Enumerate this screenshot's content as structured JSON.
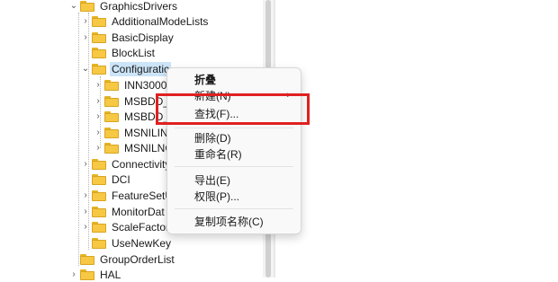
{
  "tree": {
    "items": [
      {
        "label": "GraphicsDrivers",
        "expanded": true
      },
      {
        "label": "AdditionalModeLists"
      },
      {
        "label": "BasicDisplay"
      },
      {
        "label": "BlockList"
      },
      {
        "label": "Configuratic",
        "expanded": true,
        "selected": true
      },
      {
        "label": "INN3000"
      },
      {
        "label": "MSBDD_"
      },
      {
        "label": "MSBDD_"
      },
      {
        "label": "MSNILIN"
      },
      {
        "label": "MSNILNC"
      },
      {
        "label": "Connectivity"
      },
      {
        "label": "DCI"
      },
      {
        "label": "FeatureSetU"
      },
      {
        "label": "MonitorDat"
      },
      {
        "label": "ScaleFactors"
      },
      {
        "label": "UseNewKey"
      },
      {
        "label": "GroupOrderList"
      },
      {
        "label": "HAL"
      }
    ]
  },
  "context_menu": {
    "collapse": "折叠",
    "new": "新建(N)",
    "find": "查找(F)...",
    "delete": "删除(D)",
    "rename": "重命名(R)",
    "export": "导出(E)",
    "permissions": "权限(P)...",
    "copy_key_name": "复制项名称(C)"
  },
  "icons": {
    "chevron_right": "›",
    "chevron_down": "⌄",
    "submenu_arrow": "›"
  },
  "colors": {
    "highlight": "#e02020",
    "selection": "#cce4f7",
    "folder": "#f6c844"
  }
}
